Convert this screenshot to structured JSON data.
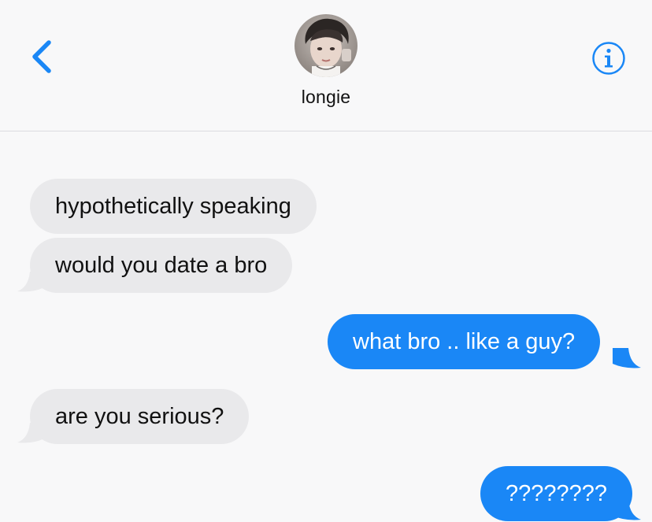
{
  "header": {
    "contact_name": "longie",
    "back_icon": "chevron-left-icon",
    "info_icon": "info-circle-icon",
    "accent_color": "#1a87f6"
  },
  "messages": [
    {
      "direction": "incoming",
      "text": "hypothetically speaking"
    },
    {
      "direction": "incoming",
      "text": "would you date a bro"
    },
    {
      "direction": "outgoing",
      "text": "what bro .. like a guy?"
    },
    {
      "direction": "incoming",
      "text": "are you serious?"
    },
    {
      "direction": "outgoing",
      "text": "????????"
    }
  ],
  "colors": {
    "incoming_bubble": "#e9e9eb",
    "outgoing_bubble": "#1a87f6",
    "background": "#f8f8f9"
  }
}
